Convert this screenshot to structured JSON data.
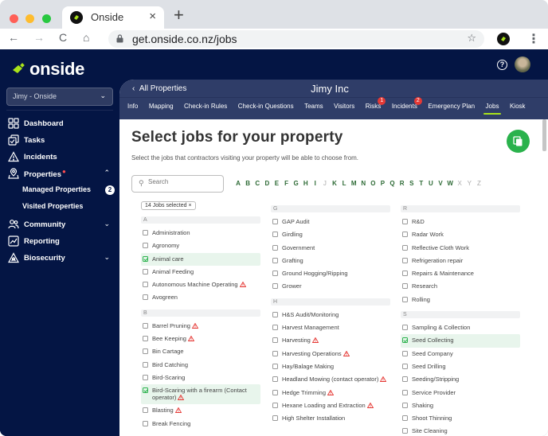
{
  "browser": {
    "tab_title": "Onside",
    "tab_close": "×",
    "new_tab": "+",
    "url": "get.onside.co.nz/jobs",
    "back": "←",
    "forward": "→",
    "reload": "C",
    "home": "⌂",
    "star": "☆",
    "menu": "⋮"
  },
  "sidebar": {
    "logo_text": "onside",
    "org_selector": "Jimy - Onside",
    "items": [
      {
        "label": "Dashboard",
        "icon": "dashboard-icon"
      },
      {
        "label": "Tasks",
        "icon": "tasks-icon"
      },
      {
        "label": "Incidents",
        "icon": "warning-icon"
      },
      {
        "label": "Properties",
        "icon": "location-pin-icon",
        "has_alert": true,
        "expanded": true,
        "children": [
          {
            "label": "Managed Properties",
            "badge": "2"
          },
          {
            "label": "Visited Properties"
          }
        ]
      },
      {
        "label": "Community",
        "icon": "community-icon",
        "collapsible": true
      },
      {
        "label": "Reporting",
        "icon": "reporting-icon"
      },
      {
        "label": "Biosecurity",
        "icon": "biosecurity-icon",
        "collapsible": true
      }
    ]
  },
  "header": {
    "help": "?"
  },
  "property": {
    "back_label": "All Properties",
    "title": "Jimy Inc",
    "tabs": [
      {
        "label": "Info"
      },
      {
        "label": "Mapping"
      },
      {
        "label": "Check-in Rules"
      },
      {
        "label": "Check-in Questions"
      },
      {
        "label": "Teams"
      },
      {
        "label": "Visitors"
      },
      {
        "label": "Risks",
        "count": "1"
      },
      {
        "label": "Incidents",
        "count": "2"
      },
      {
        "label": "Emergency Plan"
      },
      {
        "label": "Jobs",
        "active": true
      },
      {
        "label": "Kiosk"
      }
    ]
  },
  "jobs": {
    "title": "Select jobs for your property",
    "subtitle": "Select the jobs that contractors visiting your property will be able to choose from.",
    "search_placeholder": "Search",
    "alphabet": [
      {
        "l": "A"
      },
      {
        "l": "B"
      },
      {
        "l": "C"
      },
      {
        "l": "D"
      },
      {
        "l": "E"
      },
      {
        "l": "F"
      },
      {
        "l": "G"
      },
      {
        "l": "H"
      },
      {
        "l": "I"
      },
      {
        "l": "J",
        "disabled": true
      },
      {
        "l": "K"
      },
      {
        "l": "L"
      },
      {
        "l": "M"
      },
      {
        "l": "N"
      },
      {
        "l": "O"
      },
      {
        "l": "P"
      },
      {
        "l": "Q"
      },
      {
        "l": "R"
      },
      {
        "l": "S"
      },
      {
        "l": "T"
      },
      {
        "l": "U"
      },
      {
        "l": "V"
      },
      {
        "l": "W"
      },
      {
        "l": "X",
        "disabled": true
      },
      {
        "l": "Y",
        "disabled": true
      },
      {
        "l": "Z",
        "disabled": true
      }
    ],
    "selected_chip": "14 Jobs selected",
    "chip_close": "×",
    "columns": [
      [
        {
          "letter": "A",
          "items": [
            {
              "name": "Administration"
            },
            {
              "name": "Agronomy"
            },
            {
              "name": "Animal care",
              "checked": true
            },
            {
              "name": "Animal Feeding"
            },
            {
              "name": "Autonomous Machine Operating",
              "warning": true
            },
            {
              "name": "Avogreen"
            }
          ]
        },
        {
          "letter": "B",
          "items": [
            {
              "name": "Barrel Pruning",
              "warning": true
            },
            {
              "name": "Bee Keeping",
              "warning": true
            },
            {
              "name": "Bin Cartage"
            },
            {
              "name": "Bird Catching"
            },
            {
              "name": "Bird-Scaring"
            },
            {
              "name": "Bird-Scaring with a firearm (Contact operator)",
              "checked": true,
              "warning": true
            },
            {
              "name": "Blasting",
              "warning": true
            },
            {
              "name": "Break Fencing"
            }
          ]
        }
      ],
      [
        {
          "letter": "G",
          "items": [
            {
              "name": "GAP Audit"
            },
            {
              "name": "Girdling"
            },
            {
              "name": "Government"
            },
            {
              "name": "Grafting"
            },
            {
              "name": "Ground Hogging/Ripping"
            },
            {
              "name": "Grower"
            }
          ]
        },
        {
          "letter": "H",
          "items": [
            {
              "name": "H&S Audit/Monitoring"
            },
            {
              "name": "Harvest Management"
            },
            {
              "name": "Harvesting",
              "warning": true
            },
            {
              "name": "Harvesting Operations",
              "warning": true
            },
            {
              "name": "Hay/Balage Making"
            },
            {
              "name": "Headland Mowing (contact operator)",
              "warning": true
            },
            {
              "name": "Hedge Trimming",
              "warning": true
            },
            {
              "name": "Hexane Loading and Extraction",
              "warning": true
            },
            {
              "name": "High Shelter Installation"
            }
          ]
        }
      ],
      [
        {
          "letter": "R",
          "items": [
            {
              "name": "R&D"
            },
            {
              "name": "Radar Work"
            },
            {
              "name": "Reflective Cloth Work"
            },
            {
              "name": "Refrigeration repair"
            },
            {
              "name": "Repairs & Maintenance"
            },
            {
              "name": "Research"
            },
            {
              "name": "Rolling"
            }
          ]
        },
        {
          "letter": "S",
          "items": [
            {
              "name": "Sampling & Collection"
            },
            {
              "name": "Seed Collecting",
              "checked": true
            },
            {
              "name": "Seed Company"
            },
            {
              "name": "Seed Drilling"
            },
            {
              "name": "Seeding/Stripping"
            },
            {
              "name": "Service Provider"
            },
            {
              "name": "Shaking"
            },
            {
              "name": "Shoot Thinning"
            },
            {
              "name": "Site Cleaning"
            }
          ]
        }
      ]
    ]
  },
  "colors": {
    "sidebar_bg": "#041544",
    "property_header_bg": "#2f3d68",
    "accent_green": "#2ab24c",
    "brand_lime": "#a9e21a",
    "alert_red": "#e53935",
    "letter_link": "#2d6a35"
  }
}
